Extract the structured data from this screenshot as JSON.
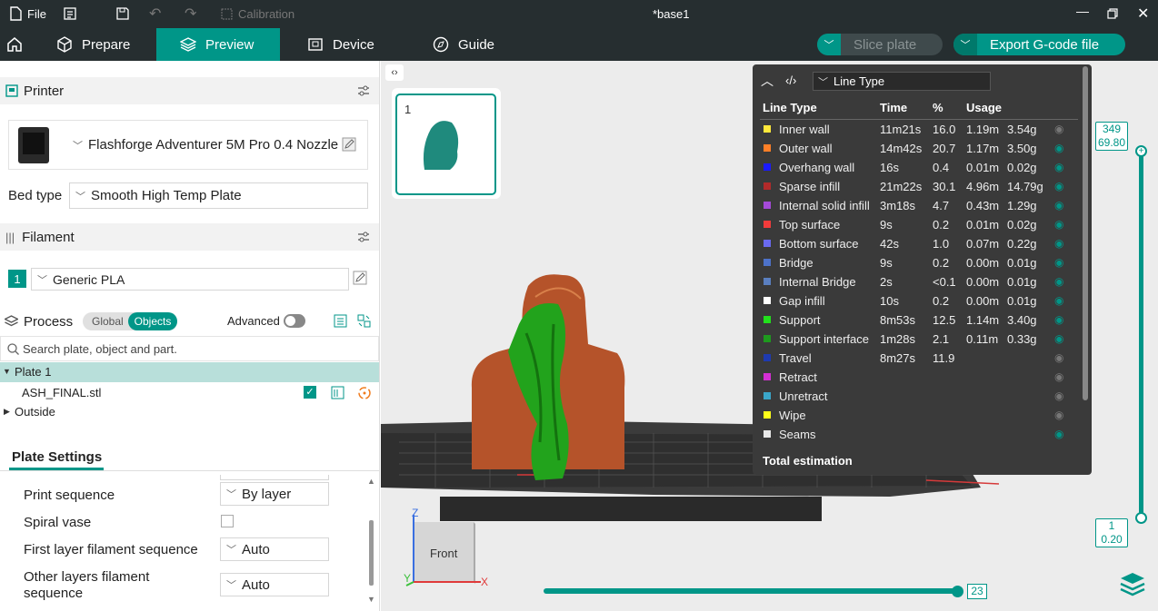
{
  "titlebar": {
    "file_label": "File",
    "calibration_label": "Calibration",
    "doc_title": "*base1"
  },
  "tabs": {
    "prepare": "Prepare",
    "preview": "Preview",
    "device": "Device",
    "guide": "Guide"
  },
  "actions": {
    "slice_label": "Slice plate",
    "export_label": "Export G-code file"
  },
  "printer": {
    "section_label": "Printer",
    "name": "Flashforge Adventurer 5M Pro 0.4 Nozzle",
    "bed_type_label": "Bed type",
    "bed_type_value": "Smooth High Temp Plate"
  },
  "filament": {
    "section_label": "Filament",
    "slot_number": "1",
    "name": "Generic PLA"
  },
  "process": {
    "section_label": "Process",
    "toggle_global": "Global",
    "toggle_objects": "Objects",
    "advanced_label": "Advanced",
    "search_placeholder": "Search plate, object and part.",
    "tree": {
      "plate": "Plate 1",
      "object": "ASH_FINAL.stl",
      "outside": "Outside"
    }
  },
  "plate_settings": {
    "title": "Plate Settings",
    "print_sequence_label": "Print sequence",
    "print_sequence_value": "By layer",
    "spiral_vase_label": "Spiral vase",
    "first_layer_label": "First layer filament sequence",
    "first_layer_value": "Auto",
    "other_layers_label_1": "Other layers filament",
    "other_layers_label_2": "sequence",
    "other_layers_value": "Auto"
  },
  "viewport": {
    "plate_thumb_number": "1",
    "cube_face": "Front",
    "axis_x": "X",
    "axis_y": "Y",
    "axis_z": "Z",
    "layer_top_num": "349",
    "layer_top_height": "69.80",
    "layer_bottom_num": "1",
    "layer_bottom_height": "0.20",
    "move_value": "23"
  },
  "legend": {
    "view_type": "Line Type",
    "headers": {
      "type": "Line Type",
      "time": "Time",
      "pct": "%",
      "usage": "Usage"
    },
    "rows": [
      {
        "name": "Inner wall",
        "time": "11m21s",
        "pct": "16.0",
        "m": "1.19m",
        "g": "3.54g",
        "color": "#ffe83b",
        "visible": false
      },
      {
        "name": "Outer wall",
        "time": "14m42s",
        "pct": "20.7",
        "m": "1.17m",
        "g": "3.50g",
        "color": "#ff7f27",
        "visible": true
      },
      {
        "name": "Overhang wall",
        "time": "16s",
        "pct": "0.4",
        "m": "0.01m",
        "g": "0.02g",
        "color": "#1a1aff",
        "visible": true
      },
      {
        "name": "Sparse infill",
        "time": "21m22s",
        "pct": "30.1",
        "m": "4.96m",
        "g": "14.79g",
        "color": "#b22a2a",
        "visible": true
      },
      {
        "name": "Internal solid infill",
        "time": "3m18s",
        "pct": "4.7",
        "m": "0.43m",
        "g": "1.29g",
        "color": "#a54ad9",
        "visible": true
      },
      {
        "name": "Top surface",
        "time": "9s",
        "pct": "0.2",
        "m": "0.01m",
        "g": "0.02g",
        "color": "#f23b3b",
        "visible": true
      },
      {
        "name": "Bottom surface",
        "time": "42s",
        "pct": "1.0",
        "m": "0.07m",
        "g": "0.22g",
        "color": "#6a6af0",
        "visible": true
      },
      {
        "name": "Bridge",
        "time": "9s",
        "pct": "0.2",
        "m": "0.00m",
        "g": "0.01g",
        "color": "#4d72c9",
        "visible": true
      },
      {
        "name": "Internal Bridge",
        "time": "2s",
        "pct": "<0.1",
        "m": "0.00m",
        "g": "0.01g",
        "color": "#5a7fc0",
        "visible": true
      },
      {
        "name": "Gap infill",
        "time": "10s",
        "pct": "0.2",
        "m": "0.00m",
        "g": "0.01g",
        "color": "#ffffff",
        "visible": true
      },
      {
        "name": "Support",
        "time": "8m53s",
        "pct": "12.5",
        "m": "1.14m",
        "g": "3.40g",
        "color": "#22e01c",
        "visible": true
      },
      {
        "name": "Support interface",
        "time": "1m28s",
        "pct": "2.1",
        "m": "0.11m",
        "g": "0.33g",
        "color": "#1e9a1e",
        "visible": true
      },
      {
        "name": "Travel",
        "time": "8m27s",
        "pct": "11.9",
        "m": "",
        "g": "",
        "color": "#1e3ab0",
        "visible": false
      },
      {
        "name": "Retract",
        "time": "",
        "pct": "",
        "m": "",
        "g": "",
        "color": "#d42fd4",
        "visible": false
      },
      {
        "name": "Unretract",
        "time": "",
        "pct": "",
        "m": "",
        "g": "",
        "color": "#3aa6c9",
        "visible": false
      },
      {
        "name": "Wipe",
        "time": "",
        "pct": "",
        "m": "",
        "g": "",
        "color": "#ffff1a",
        "visible": false
      },
      {
        "name": "Seams",
        "time": "",
        "pct": "",
        "m": "",
        "g": "",
        "color": "#e8e8e8",
        "visible": true
      }
    ],
    "total_label": "Total estimation"
  },
  "colors": {
    "accent": "#009688",
    "dark": "#262e30"
  }
}
